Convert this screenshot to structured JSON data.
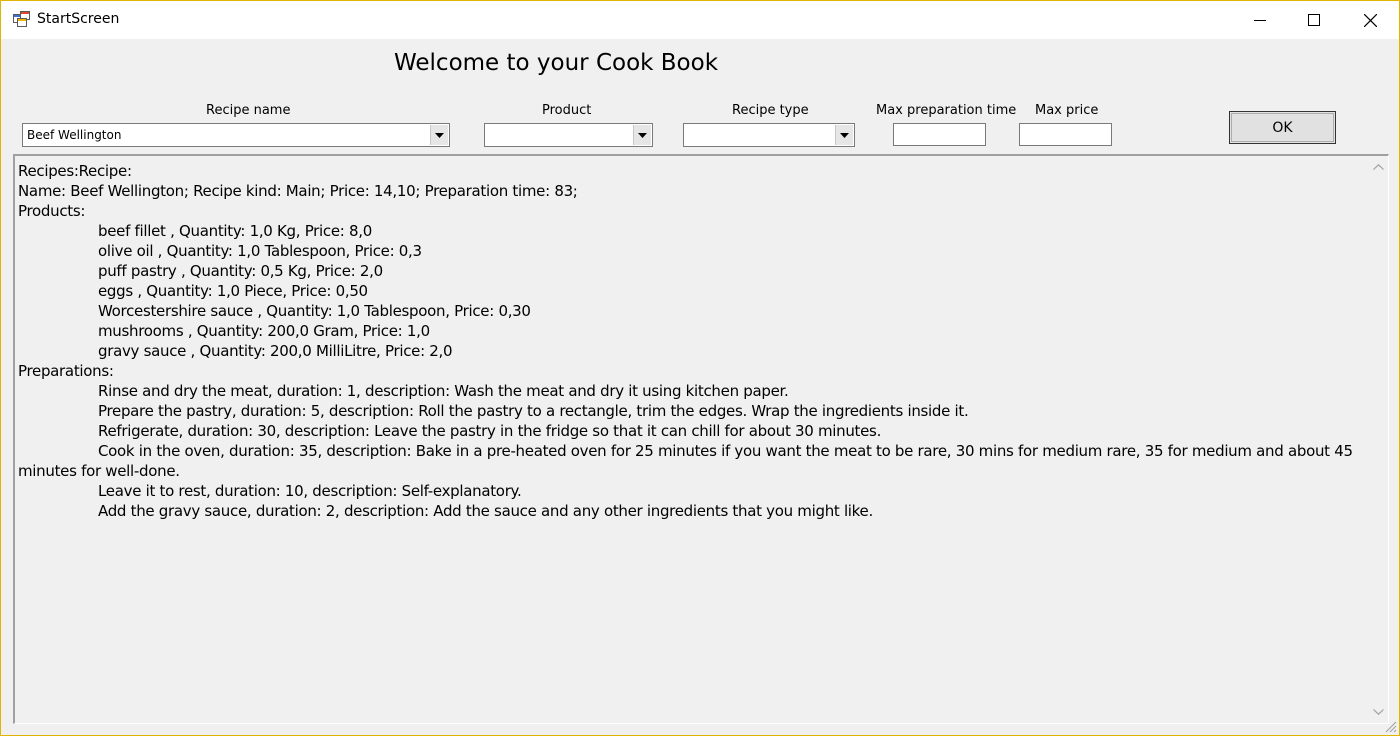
{
  "window": {
    "title": "StartScreen"
  },
  "header": {
    "welcome": "Welcome to your Cook Book"
  },
  "filters": {
    "recipe_name_label": "Recipe name",
    "recipe_name_value": "Beef Wellington",
    "product_label": "Product",
    "product_value": "",
    "recipe_type_label": "Recipe type",
    "recipe_type_value": "",
    "max_prep_label": "Max preparation time",
    "max_prep_value": "",
    "max_price_label": "Max price",
    "max_price_value": "",
    "ok_label": "OK"
  },
  "output": {
    "lines": [
      "Recipes:Recipe:",
      "Name: Beef Wellington;  Recipe kind: Main;  Price: 14,10;  Preparation time: 83;",
      "Products:",
      "beef fillet , Quantity: 1,0 Kg,  Price: 8,0",
      "olive oil , Quantity: 1,0 Tablespoon,  Price: 0,3",
      "puff pastry , Quantity: 0,5 Kg,  Price: 2,0",
      "eggs , Quantity: 1,0 Piece,  Price: 0,50",
      "Worcestershire sauce , Quantity: 1,0 Tablespoon,  Price: 0,30",
      "mushrooms , Quantity: 200,0 Gram,  Price: 1,0",
      "gravy sauce , Quantity: 200,0 MilliLitre,  Price: 2,0",
      "Preparations:",
      "Rinse and dry the meat, duration: 1, description: Wash the meat and dry it using kitchen paper.",
      "Prepare the pastry, duration: 5, description: Roll the pastry to a rectangle, trim the edges. Wrap the ingredients inside it.",
      "Refrigerate, duration: 30, description: Leave the pastry in the fridge so that it can chill for about 30 minutes.",
      "Cook in the oven, duration: 35, description: Bake in a pre-heated oven for 25 minutes if you want the meat to be rare, 30 mins for medium rare, 35 for medium and about 45 minutes for well-done.",
      "Leave it to rest, duration: 10, description: Self-explanatory.",
      "Add the gravy sauce, duration: 2, description: Add the sauce and any other ingredients that you might like."
    ]
  },
  "icons": {
    "app": "app-form-icon",
    "minimize": "minimize-icon",
    "maximize": "maximize-icon",
    "close": "close-icon",
    "dropdown": "chevron-down-icon",
    "scroll_up": "scroll-up-icon",
    "scroll_down": "scroll-down-icon",
    "grip": "resize-grip-icon"
  },
  "colors": {
    "window_border": "#e1b400",
    "background": "#f0f0f0"
  }
}
